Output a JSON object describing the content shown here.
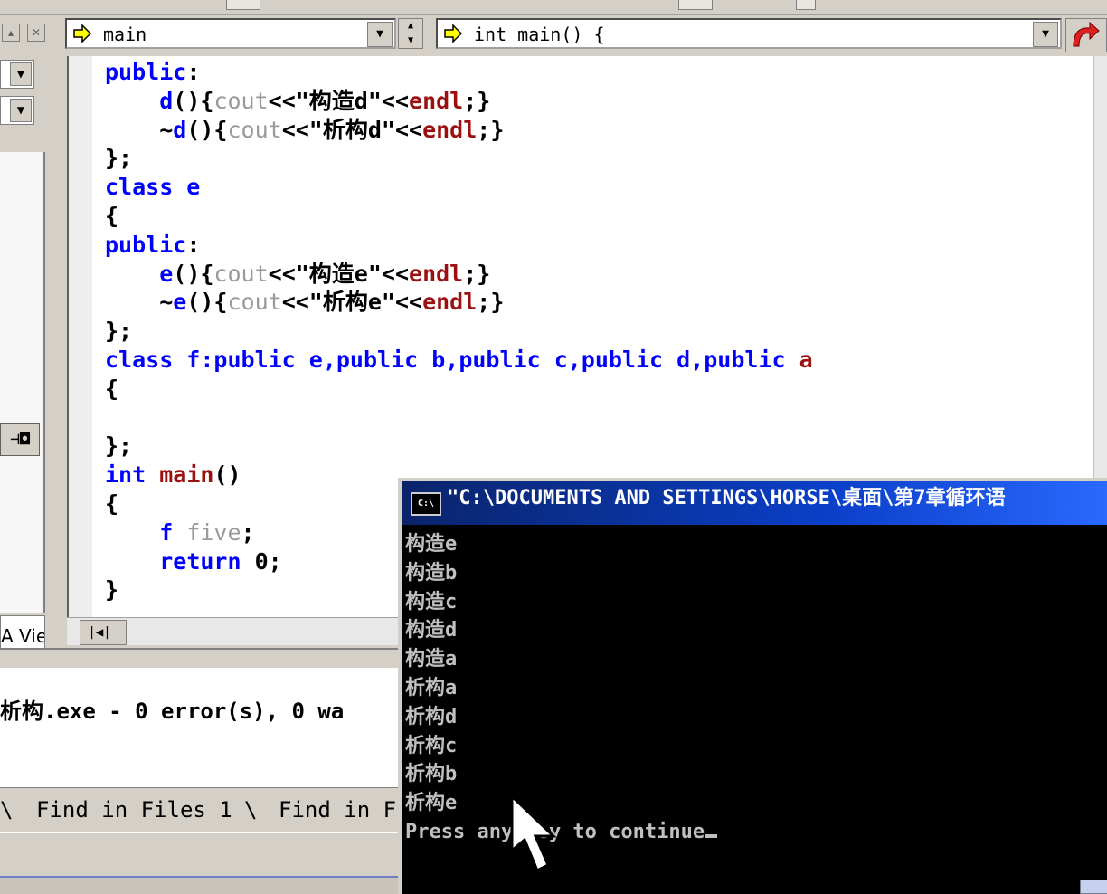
{
  "combos": {
    "member": "main",
    "function": "int main() {"
  },
  "left_panel": {
    "tab_label": "A Vie"
  },
  "editor": {
    "lines": [
      [
        {
          "t": "public",
          "c": "kw"
        },
        {
          "t": ":",
          "c": "bk"
        }
      ],
      [
        {
          "t": "    ",
          "c": "bk"
        },
        {
          "t": "d",
          "c": "id"
        },
        {
          "t": "(){",
          "c": "bk"
        },
        {
          "t": "cout",
          "c": "gy"
        },
        {
          "t": "<<\"构造d\"<<",
          "c": "bk"
        },
        {
          "t": "endl",
          "c": "fn"
        },
        {
          "t": ";}",
          "c": "bk"
        }
      ],
      [
        {
          "t": "    ~",
          "c": "bk"
        },
        {
          "t": "d",
          "c": "id"
        },
        {
          "t": "(){",
          "c": "bk"
        },
        {
          "t": "cout",
          "c": "gy"
        },
        {
          "t": "<<\"析构d\"<<",
          "c": "bk"
        },
        {
          "t": "endl",
          "c": "fn"
        },
        {
          "t": ";}",
          "c": "bk"
        }
      ],
      [
        {
          "t": "};",
          "c": "bk"
        }
      ],
      [
        {
          "t": "class e",
          "c": "kw"
        }
      ],
      [
        {
          "t": "{",
          "c": "bk"
        }
      ],
      [
        {
          "t": "public",
          "c": "kw"
        },
        {
          "t": ":",
          "c": "bk"
        }
      ],
      [
        {
          "t": "    ",
          "c": "bk"
        },
        {
          "t": "e",
          "c": "id"
        },
        {
          "t": "(){",
          "c": "bk"
        },
        {
          "t": "cout",
          "c": "gy"
        },
        {
          "t": "<<\"构造e\"<<",
          "c": "bk"
        },
        {
          "t": "endl",
          "c": "fn"
        },
        {
          "t": ";}",
          "c": "bk"
        }
      ],
      [
        {
          "t": "    ~",
          "c": "bk"
        },
        {
          "t": "e",
          "c": "id"
        },
        {
          "t": "(){",
          "c": "bk"
        },
        {
          "t": "cout",
          "c": "gy"
        },
        {
          "t": "<<\"析构e\"<<",
          "c": "bk"
        },
        {
          "t": "endl",
          "c": "fn"
        },
        {
          "t": ";}",
          "c": "bk"
        }
      ],
      [
        {
          "t": "};",
          "c": "bk"
        }
      ],
      [
        {
          "t": "class f:public e,public b,public c,public d,public ",
          "c": "kw"
        },
        {
          "t": "a",
          "c": "fn"
        }
      ],
      [
        {
          "t": "{",
          "c": "bk"
        }
      ],
      [
        {
          "t": "",
          "c": "bk"
        }
      ],
      [
        {
          "t": "};",
          "c": "bk"
        }
      ],
      [
        {
          "t": "int ",
          "c": "kw"
        },
        {
          "t": "main",
          "c": "fn"
        },
        {
          "t": "()",
          "c": "bk"
        }
      ],
      [
        {
          "t": "{",
          "c": "bk"
        }
      ],
      [
        {
          "t": "    ",
          "c": "bk"
        },
        {
          "t": "f",
          "c": "kw"
        },
        {
          "t": " five",
          "c": "gy"
        },
        {
          "t": ";",
          "c": "bk"
        }
      ],
      [
        {
          "t": "    ",
          "c": "bk"
        },
        {
          "t": "return",
          "c": "kw"
        },
        {
          "t": " 0;",
          "c": "bk"
        }
      ],
      [
        {
          "t": "}",
          "c": "bk"
        }
      ]
    ]
  },
  "output": {
    "build_line": "析构.exe - 0 error(s), 0 wa"
  },
  "output_tabs": [
    "Find in Files 1",
    "Find in F"
  ],
  "console": {
    "title": "\"C:\\DOCUMENTS AND SETTINGS\\HORSE\\桌面\\第7章循环语",
    "icon_label": "C:\\",
    "lines": [
      "构造e",
      "构造b",
      "构造c",
      "构造d",
      "构造a",
      "析构a",
      "析构d",
      "析构c",
      "析构b",
      "析构e"
    ],
    "prompt": "Press any key to continue"
  }
}
